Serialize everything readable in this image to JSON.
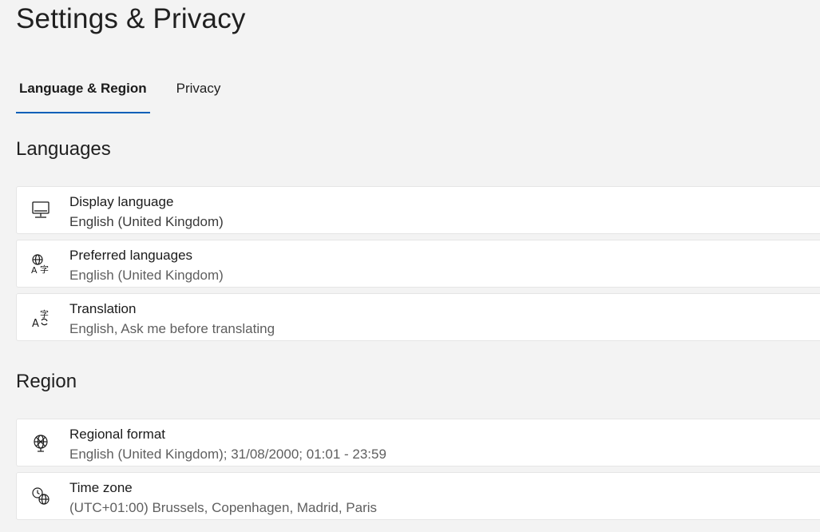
{
  "header": {
    "title": "Settings & Privacy"
  },
  "tabs": [
    {
      "label": "Language & Region",
      "active": true
    },
    {
      "label": "Privacy",
      "active": false
    }
  ],
  "sections": {
    "languages": {
      "heading": "Languages",
      "items": [
        {
          "title": "Display language",
          "subtitle": "English (United Kingdom)",
          "icon": "monitor-icon"
        },
        {
          "title": "Preferred languages",
          "subtitle": "English (United Kingdom)",
          "icon": "language-globe-icon"
        },
        {
          "title": "Translation",
          "subtitle": "English, Ask me before translating",
          "icon": "translate-icon"
        }
      ]
    },
    "region": {
      "heading": "Region",
      "items": [
        {
          "title": "Regional format",
          "subtitle": "English (United Kingdom); 31/08/2000; 01:01 - 23:59",
          "icon": "globe-format-icon"
        },
        {
          "title": "Time zone",
          "subtitle": "(UTC+01:00) Brussels, Copenhagen, Madrid, Paris",
          "icon": "clock-globe-icon"
        }
      ]
    }
  },
  "colors": {
    "accent": "#005fb8",
    "background": "#f3f3f3",
    "card": "#ffffff"
  }
}
